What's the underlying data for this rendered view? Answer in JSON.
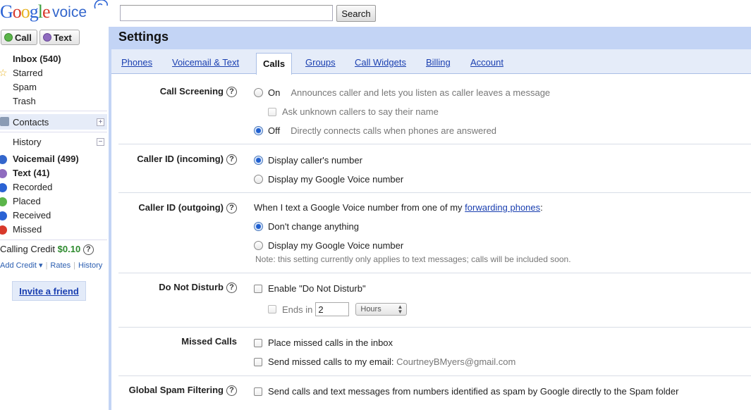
{
  "header": {
    "logo_google": "Google",
    "logo_voice": "voice",
    "search_value": "",
    "search_button": "Search"
  },
  "leftnav": {
    "call_button": "Call",
    "text_button": "Text",
    "items": [
      {
        "label": "Inbox (540)",
        "bold": true
      },
      {
        "label": "Starred",
        "icon": "star-icon"
      },
      {
        "label": "Spam"
      },
      {
        "label": "Trash"
      }
    ],
    "contacts": "Contacts",
    "history": "History",
    "history_items": [
      {
        "label": "Voicemail (499)",
        "icon": "voicemail-icon",
        "color": "#3366cc"
      },
      {
        "label": "Text (41)",
        "icon": "text-icon",
        "color": "#8f6bbf"
      },
      {
        "label": "Recorded",
        "icon": "recorded-icon",
        "color": "#2a62d4"
      },
      {
        "label": "Placed",
        "icon": "placed-icon",
        "color": "#5bb54a"
      },
      {
        "label": "Received",
        "icon": "received-icon",
        "color": "#2a62d4"
      },
      {
        "label": "Missed",
        "icon": "missed-icon",
        "color": "#d8392b"
      }
    ],
    "calling_credit_label": "Calling Credit",
    "calling_credit_amount": "$0.10",
    "add_credit": "Add Credit ▾",
    "rates": "Rates",
    "history_link": "History",
    "invite": "Invite a friend"
  },
  "main": {
    "title": "Settings",
    "tabs": [
      "Phones",
      "Voicemail & Text",
      "Calls",
      "Groups",
      "Call Widgets",
      "Billing",
      "Account"
    ],
    "active_tab": "Calls",
    "call_screening": {
      "label": "Call Screening",
      "on": "On",
      "on_desc": "Announces caller and lets you listen as caller leaves a message",
      "ask_unknown": "Ask unknown callers to say their name",
      "off": "Off",
      "off_desc": "Directly connects calls when phones are answered",
      "selected": "Off"
    },
    "caller_id_incoming": {
      "label": "Caller ID (incoming)",
      "opt1": "Display caller's number",
      "opt2": "Display my Google Voice number",
      "selected": "opt1"
    },
    "caller_id_outgoing": {
      "label": "Caller ID (outgoing)",
      "intro": "When I text a Google Voice number from one of my",
      "intro_link": "forwarding phones",
      "intro_end": ":",
      "opt1": "Don't change anything",
      "opt2": "Display my Google Voice number",
      "note": "Note: this setting currently only applies to text messages; calls will be included soon.",
      "selected": "opt1"
    },
    "do_not_disturb": {
      "label": "Do Not Disturb",
      "enable": "Enable \"Do Not Disturb\"",
      "ends_in": "Ends in",
      "ends_value": "2",
      "unit": "Hours"
    },
    "missed_calls": {
      "label": "Missed Calls",
      "opt1": "Place missed calls in the inbox",
      "opt2": "Send missed calls to my email:",
      "email": "CourtneyBMyers@gmail.com"
    },
    "spam": {
      "label": "Global Spam Filtering",
      "opt": "Send calls and text messages from numbers identified as spam by Google directly to the Spam folder"
    }
  }
}
